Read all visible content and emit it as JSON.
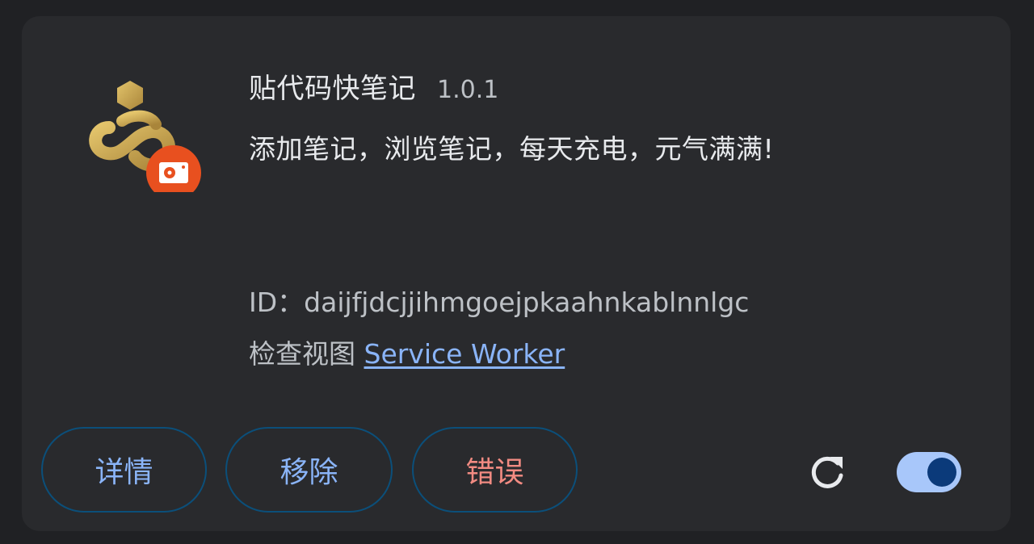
{
  "extension": {
    "name": "贴代码快笔记",
    "version": "1.0.1",
    "description": "添加笔记，浏览笔记，每天充电，元气满满!",
    "id_text": "ID：daijfjdcjjihmgoejpkaahnkablnnlgc",
    "inspect_label": "检查视图",
    "inspect_link": "Service Worker",
    "icon": "gold-loop-logo-icon",
    "badge_icon": "red-service-worker-badge-icon"
  },
  "actions": {
    "details_label": "详情",
    "remove_label": "移除",
    "errors_label": "错误"
  },
  "controls": {
    "reload_icon": "reload-icon",
    "enabled": true
  },
  "colors": {
    "background": "#202124",
    "card": "#292a2d",
    "accent_blue": "#8ab4f8",
    "error_red": "#f28b82",
    "toggle_track": "#a8c7fa",
    "toggle_knob": "#0b3a7a",
    "badge_red": "#e8501f",
    "logo_gold": "#c9a54a"
  }
}
